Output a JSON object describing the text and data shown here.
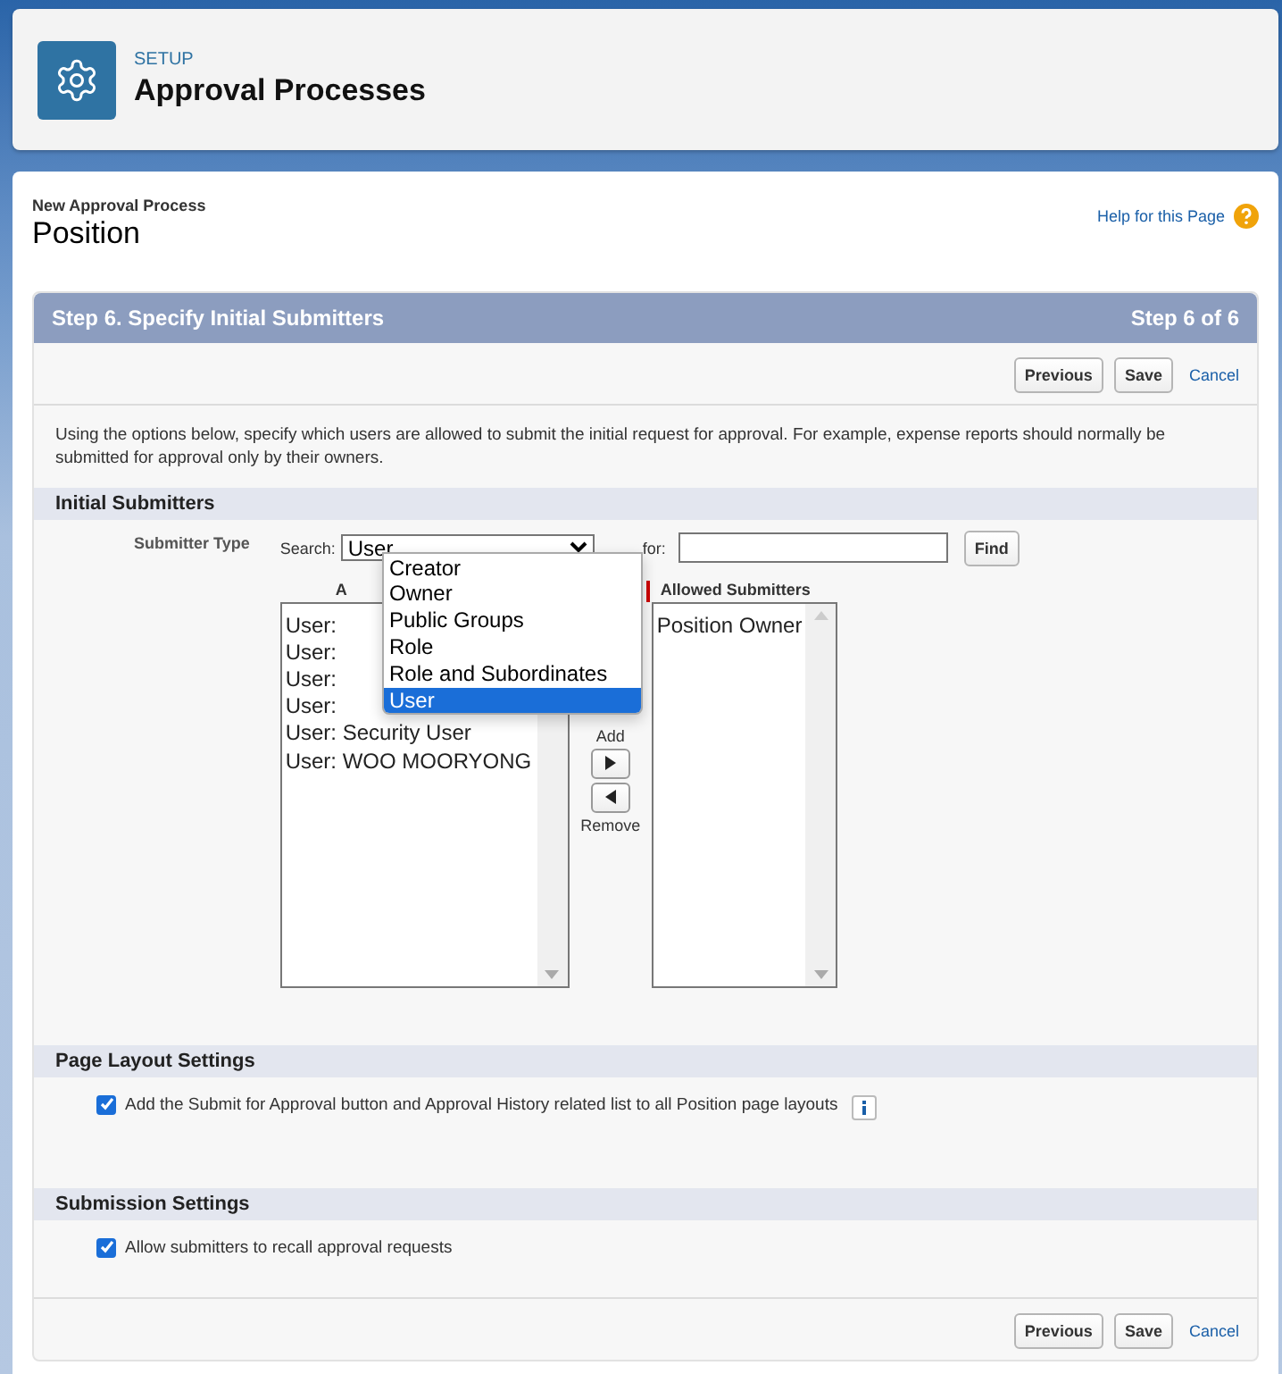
{
  "header": {
    "eyebrow": "SETUP",
    "title": "Approval Processes"
  },
  "page": {
    "subtitle": "New Approval Process",
    "title": "Position",
    "help_link": "Help for this Page"
  },
  "step": {
    "title": "Step 6. Specify Initial Submitters",
    "progress": "Step 6 of 6"
  },
  "top_buttons": [
    {
      "label": "Previous",
      "kind": "button"
    },
    {
      "label": "Save",
      "kind": "button"
    },
    {
      "label": "Cancel",
      "kind": "link"
    }
  ],
  "description": "Using the options below, specify which users are allowed to submit the initial request for approval. For example, expense reports should normally be submitted for approval only by their owners.",
  "initial_submitters": {
    "heading": "Initial Submitters",
    "field_label": "Submitter Type",
    "search_label": "Search:",
    "search_value": "User",
    "for_label": "for:",
    "find_button": "Find",
    "dropdown_options": [
      {
        "label": "Creator",
        "selected": false
      },
      {
        "label": "Owner",
        "selected": false
      },
      {
        "label": "Public Groups",
        "selected": false
      },
      {
        "label": "Role",
        "selected": false
      },
      {
        "label": "Role and Subordinates",
        "selected": false
      },
      {
        "label": "User",
        "selected": true
      }
    ],
    "available_heading": "A",
    "available": [
      "User:",
      "User:",
      "User:",
      "User:",
      "User: Security User",
      "User: WOO MOORYONG"
    ],
    "add_label": "Add",
    "remove_label": "Remove",
    "allowed_heading": "Allowed Submitters",
    "allowed": [
      "Position Owner"
    ]
  },
  "page_layout": {
    "heading": "Page Layout Settings",
    "option": {
      "label": "Add the Submit for Approval button and Approval History related list to all Position page layouts",
      "checked": true
    }
  },
  "submission": {
    "heading": "Submission Settings",
    "option": {
      "label": "Allow submitters to recall approval requests",
      "checked": true
    }
  },
  "bottom_buttons": [
    {
      "label": "Previous",
      "kind": "button"
    },
    {
      "label": "Save",
      "kind": "button"
    },
    {
      "label": "Cancel",
      "kind": "link"
    }
  ]
}
